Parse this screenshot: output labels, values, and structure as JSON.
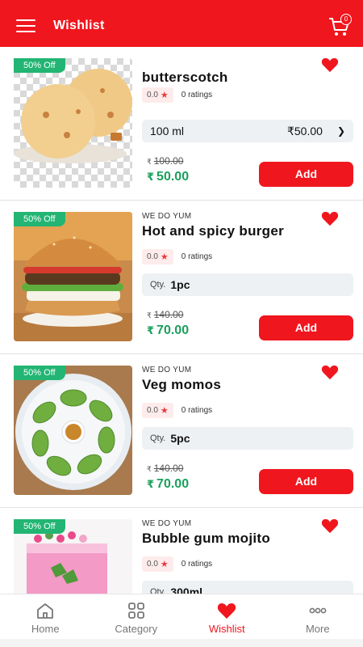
{
  "header": {
    "title": "Wishlist",
    "cart_count": "0"
  },
  "items": [
    {
      "discount": "50% Off",
      "brand": "",
      "name": "butterscotch",
      "rating": "0.0",
      "ratings_text": "0 ratings",
      "variant": {
        "size": "100 ml",
        "price": "₹50.00"
      },
      "mrp_symbol": "₹",
      "mrp": "100.00",
      "price_symbol": "₹",
      "price": "50.00",
      "add_label": "Add"
    },
    {
      "discount": "50% Off",
      "brand": "WE DO YUM",
      "name": "Hot and spicy burger",
      "rating": "0.0",
      "ratings_text": "0 ratings",
      "qty_label": "Qty.",
      "qty": "1pc",
      "mrp_symbol": "₹",
      "mrp": "140.00",
      "price_symbol": "₹",
      "price": "70.00",
      "add_label": "Add"
    },
    {
      "discount": "50% Off",
      "brand": "WE DO YUM",
      "name": "Veg momos",
      "rating": "0.0",
      "ratings_text": "0 ratings",
      "qty_label": "Qty.",
      "qty": "5pc",
      "mrp_symbol": "₹",
      "mrp": "140.00",
      "price_symbol": "₹",
      "price": "70.00",
      "add_label": "Add"
    },
    {
      "discount": "50% Off",
      "brand": "WE DO YUM",
      "name": "Bubble gum mojito",
      "rating": "0.0",
      "ratings_text": "0 ratings",
      "qty_label": "Qty.",
      "qty": "300ml"
    }
  ],
  "nav": {
    "home": "Home",
    "category": "Category",
    "wishlist": "Wishlist",
    "more": "More"
  },
  "colors": {
    "primary": "#f0161e",
    "discount": "#22b573",
    "price": "#1aa05c"
  }
}
